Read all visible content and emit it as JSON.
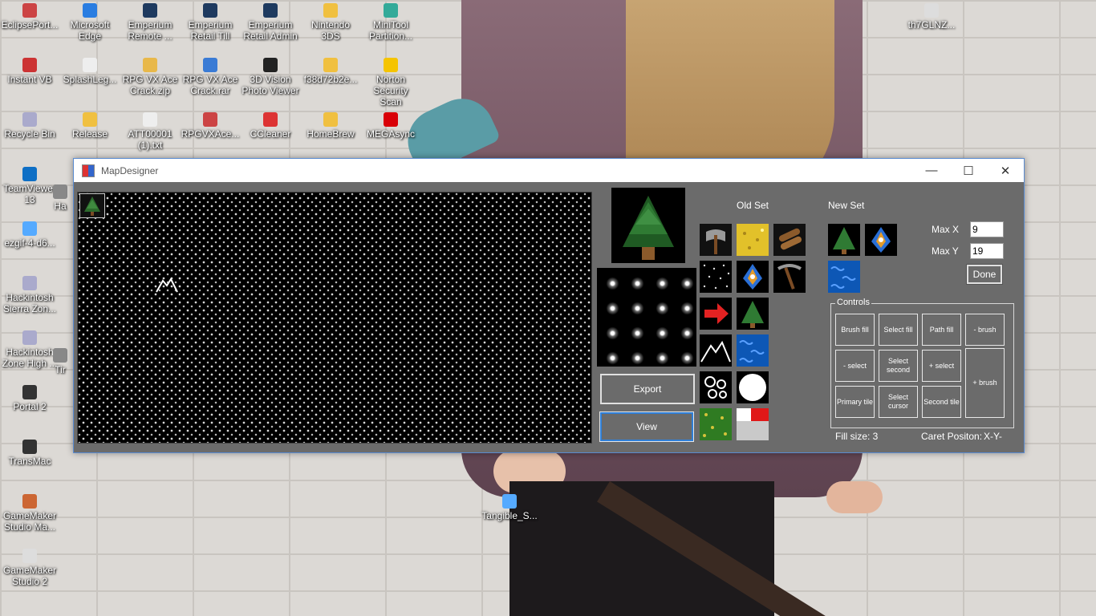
{
  "desktop": {
    "icons": [
      {
        "label": "EclipsePort...",
        "icon": "eclipse-icon",
        "color": "#c44"
      },
      {
        "label": "Microsoft Edge",
        "icon": "edge-icon",
        "color": "#2a7de1"
      },
      {
        "label": "Emperium Remote ...",
        "icon": "emperium-icon",
        "color": "#1e3a5f"
      },
      {
        "label": "Emperium Retail Till",
        "icon": "emperium-icon",
        "color": "#1e3a5f"
      },
      {
        "label": "Emperium Retail Admin",
        "icon": "emperium-icon",
        "color": "#1e3a5f"
      },
      {
        "label": "Nintendo 3DS",
        "icon": "folder-icon",
        "color": "#f0c040"
      },
      {
        "label": "MiniTool Partition...",
        "icon": "minitool-icon",
        "color": "#3a9"
      },
      {
        "label": "th7GLNZ...",
        "icon": "image-file-icon",
        "color": "#ddd"
      },
      {
        "label": "Instant VB",
        "icon": "instantvb-icon",
        "color": "#c33"
      },
      {
        "label": "SplashLeg...",
        "icon": "document-icon",
        "color": "#eee"
      },
      {
        "label": "RPG VX Ace Crack.zip",
        "icon": "zip-icon",
        "color": "#e8b84a"
      },
      {
        "label": "RPG VX Ace Crack.rar",
        "icon": "rar-icon",
        "color": "#3a7bd5"
      },
      {
        "label": "3D Vision Photo Viewer",
        "icon": "nvidia-icon",
        "color": "#222"
      },
      {
        "label": "f38d72b2e...",
        "icon": "folder-icon",
        "color": "#f0c040"
      },
      {
        "label": "Norton Security Scan",
        "icon": "norton-icon",
        "color": "#f5c400"
      },
      {
        "label": "Recycle Bin",
        "icon": "recycle-bin-icon",
        "color": "#aac"
      },
      {
        "label": "Release",
        "icon": "folder-icon",
        "color": "#f0c040"
      },
      {
        "label": "ATT00001 (1).txt",
        "icon": "text-file-icon",
        "color": "#eee"
      },
      {
        "label": "RPGVXAce...",
        "icon": "rpg-maker-icon",
        "color": "#c44"
      },
      {
        "label": "CCleaner",
        "icon": "ccleaner-icon",
        "color": "#d33"
      },
      {
        "label": "HomeBrew",
        "icon": "folder-icon",
        "color": "#f0c040"
      },
      {
        "label": "MEGAsync",
        "icon": "mega-icon",
        "color": "#d90007"
      },
      {
        "label": "TeamViewer 13",
        "icon": "teamviewer-icon",
        "color": "#0e6fc5"
      },
      {
        "label": "Ha",
        "icon": "partial-icon",
        "color": "#888"
      },
      {
        "label": "ezgif-4-d6...",
        "icon": "image-file-icon",
        "color": "#5af"
      },
      {
        "label": "Hackintosh Sierra Zon...",
        "icon": "disc-image-icon",
        "color": "#aac"
      },
      {
        "label": "Hackintosh Zone High ...",
        "icon": "disc-image-icon",
        "color": "#aac"
      },
      {
        "label": "Tir",
        "icon": "partial-icon",
        "color": "#888"
      },
      {
        "label": "Portal 2",
        "icon": "portal-icon",
        "color": "#333"
      },
      {
        "label": "TransMac",
        "icon": "transmac-icon",
        "color": "#333"
      },
      {
        "label": "GameMaker Studio Ma...",
        "icon": "gamemaker-icon",
        "color": "#c63"
      },
      {
        "label": "GameMaker Studio 2",
        "icon": "gamemaker-icon",
        "color": "#ddd"
      },
      {
        "label": "Tangible_S...",
        "icon": "window-file-icon",
        "color": "#5af"
      }
    ]
  },
  "window": {
    "title": "MapDesigner",
    "minimize": "—",
    "maximize": "☐",
    "close": "✕"
  },
  "sets": {
    "old_label": "Old Set",
    "new_label": "New Set",
    "old_tiles": [
      "axe-tile",
      "gold-tile",
      "wood-tile",
      "stars-tile",
      "ship-tile",
      "pickaxe-tile",
      "arrow-tile",
      "tree-tile",
      "mountain-tile",
      "water-tile",
      "cloud-tile",
      "circle-tile",
      "grass-tile",
      "red-corner-tile"
    ],
    "new_tiles": [
      "tree-tile",
      "ship-tile",
      "water-tile"
    ]
  },
  "buttons": {
    "export": "Export",
    "view": "View",
    "done": "Done"
  },
  "limits": {
    "max_x_label": "Max X",
    "max_x_value": "9",
    "max_y_label": "Max Y",
    "max_y_value": "19"
  },
  "controls": {
    "legend": "Controls",
    "brush_fill": "Brush fill",
    "select_fill": "Select fill",
    "path_fill": "Path fill",
    "minus_brush": "- brush",
    "minus_select": "- select",
    "select_second": "Select second",
    "plus_select": "+ select",
    "plus_brush": "+ brush",
    "primary_tile": "Primary tile",
    "select_cursor": "Select cursor",
    "second_tile": "Second tile"
  },
  "status": {
    "fill_size": "Fill size: 3",
    "caret_label": "Caret Positon:",
    "caret_value": "X-Y-"
  }
}
